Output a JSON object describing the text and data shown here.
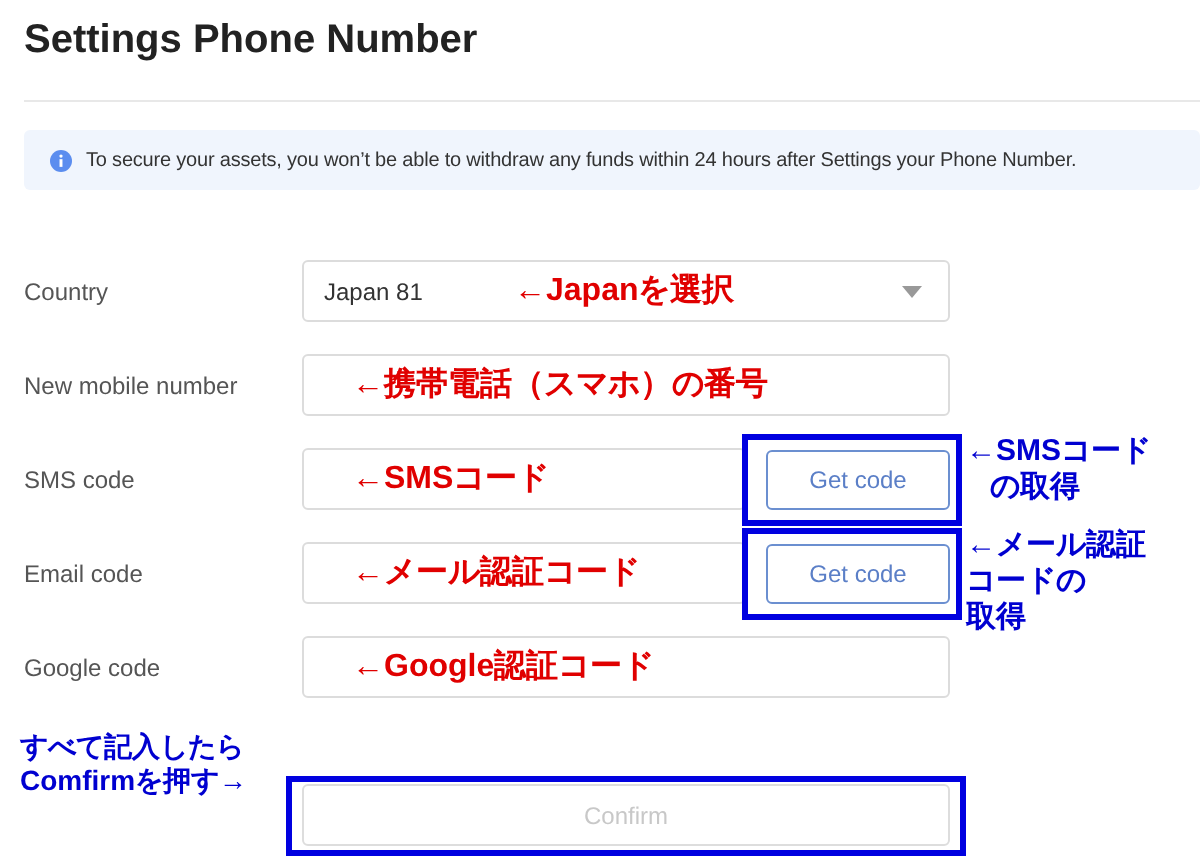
{
  "title": "Settings Phone Number",
  "notice": {
    "text": "To secure your assets, you won’t be able to withdraw any funds within 24 hours after Settings your Phone Number."
  },
  "fields": [
    {
      "label": "Country",
      "kind": "select",
      "value": "Japan 81",
      "annotation": "←Japanを選択"
    },
    {
      "label": "New mobile number",
      "kind": "text",
      "annotation": "←携帯電話（スマホ）の番号"
    },
    {
      "label": "SMS code",
      "kind": "code",
      "annotation": "←SMSコード",
      "button": "Get code",
      "callout": [
        "←SMSコード",
        "の取得"
      ]
    },
    {
      "label": "Email code",
      "kind": "code",
      "annotation": "←メール認証コード",
      "button": "Get code",
      "callout": [
        "←メール認証",
        "コードの",
        "取得"
      ]
    },
    {
      "label": "Google code",
      "kind": "text",
      "annotation": "←Google認証コード"
    }
  ],
  "confirm": {
    "label": "Confirm",
    "disabled": true,
    "callout": [
      "すべて記入したら",
      "Comfirmを押す→"
    ]
  }
}
